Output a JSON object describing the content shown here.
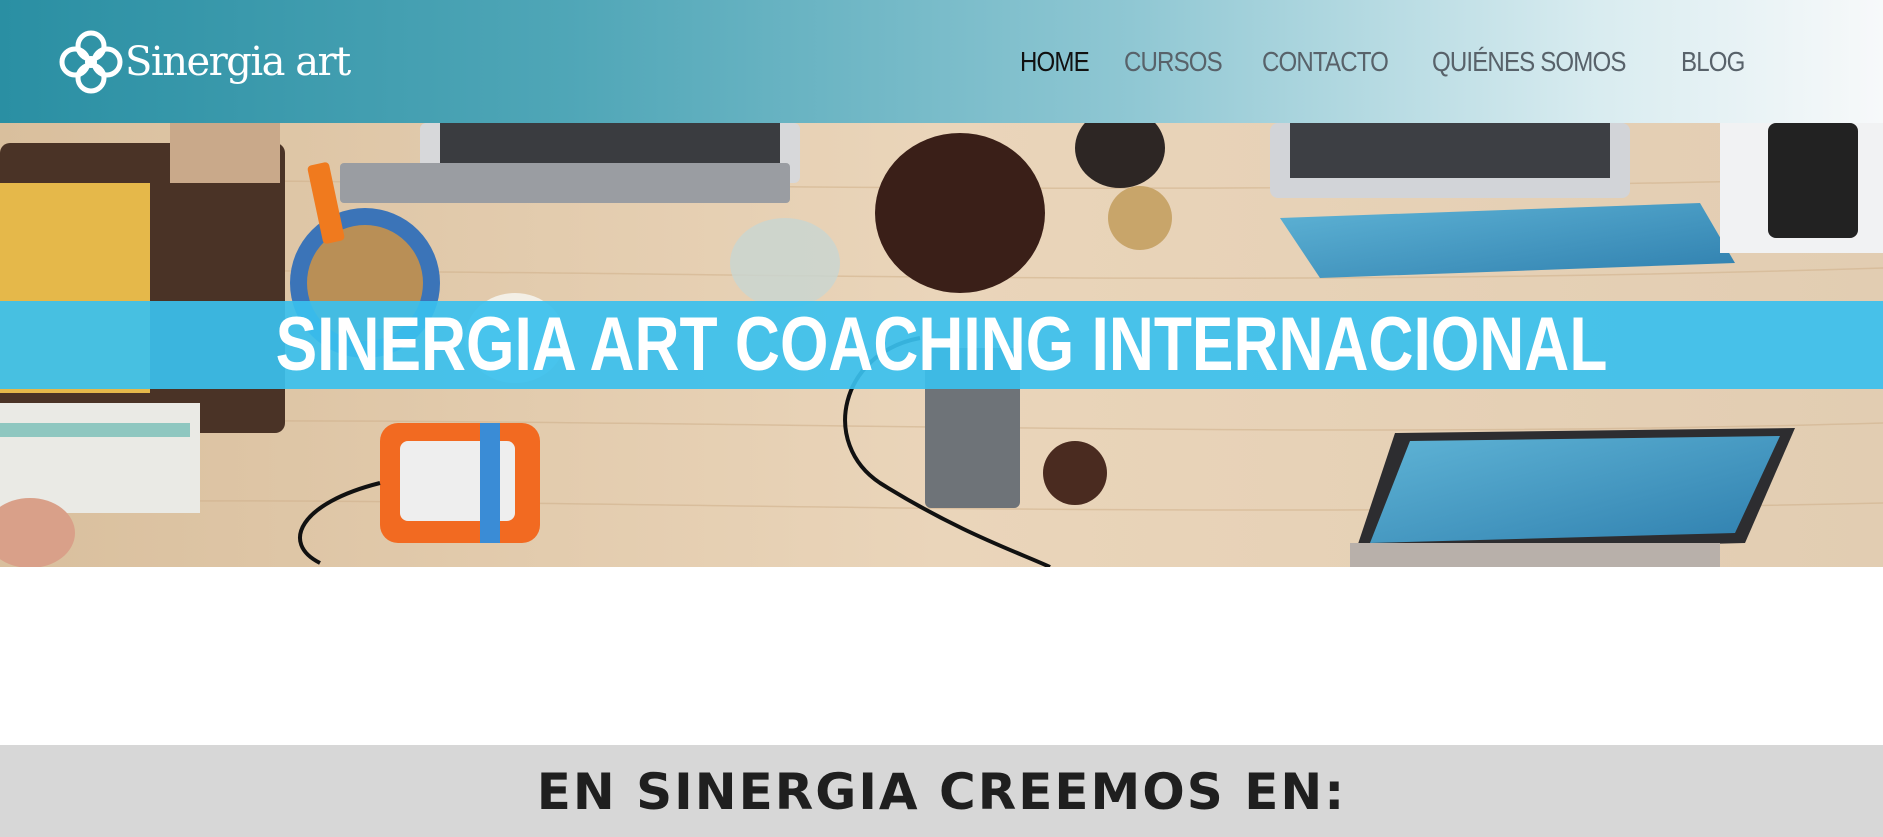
{
  "site": {
    "brand_name": "Sinergia art",
    "logo_icon": "interlocking-loops-logo-icon"
  },
  "nav": {
    "items": [
      {
        "label": "HOME",
        "active": true
      },
      {
        "label": "CURSOS",
        "active": false
      },
      {
        "label": "CONTACTO",
        "active": false
      },
      {
        "label": "QUIÉNES SOMOS",
        "active": false
      },
      {
        "label": "BLOG",
        "active": false
      }
    ]
  },
  "hero": {
    "title": "SINERGIA ART COACHING INTERNACIONAL",
    "image": "workspace-desk-photo",
    "band_color": "#3ac0ee"
  },
  "beliefs": {
    "title": "EN SINERGIA CREEMOS EN:"
  },
  "colors": {
    "header_start": "#2a8fa3",
    "header_end": "#f7f9fa",
    "section_bg": "#d7d7d7",
    "nav_text": "#58626a",
    "nav_active": "#111111"
  }
}
